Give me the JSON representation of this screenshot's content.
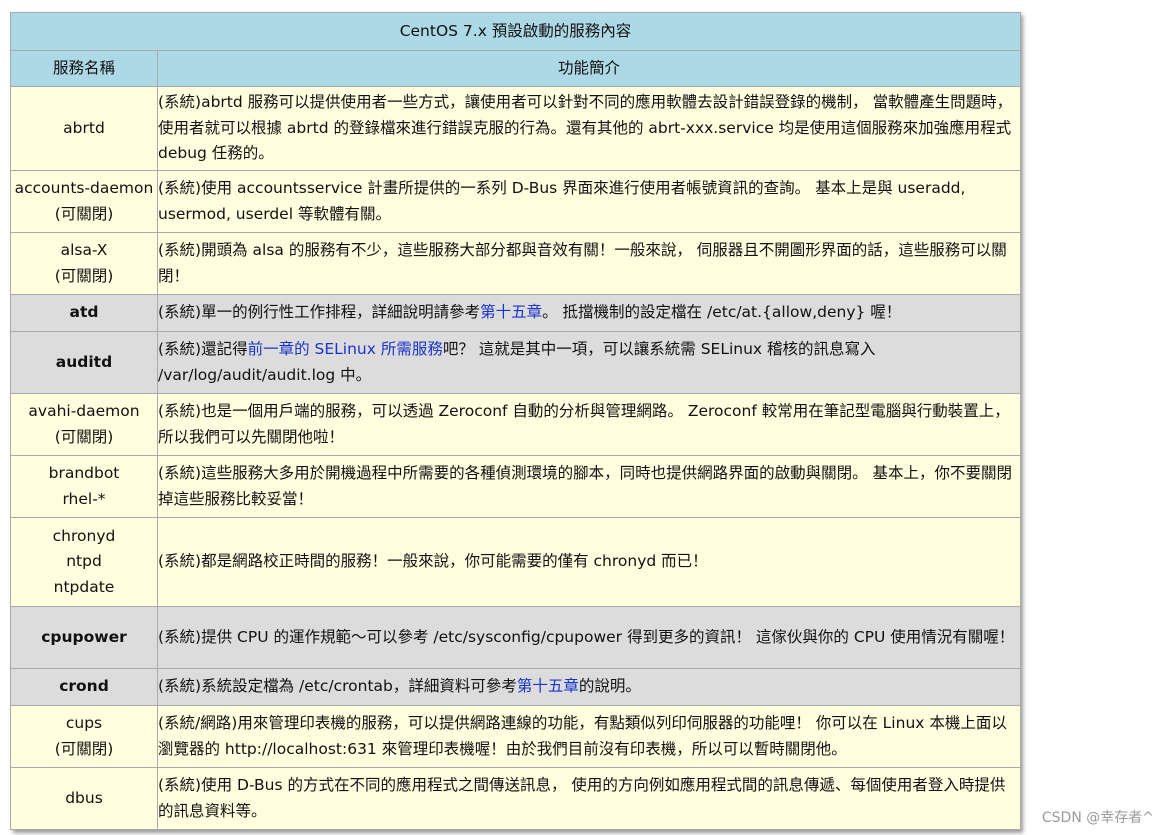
{
  "table": {
    "caption": "CentOS 7.x 預設啟動的服務內容",
    "headers": [
      "服務名稱",
      "功能簡介"
    ],
    "rows": [
      {
        "style": "yellow",
        "names": [
          "abrtd"
        ],
        "desc": [
          {
            "t": "(系統)abrtd 服務可以提供使用者一些方式，讓使用者可以針對不同的應用軟體去設計錯誤登錄的機制， 當軟體產生問題時，使用者就可以根據 abrtd 的登錄檔來進行錯誤克服的行為。還有其他的 abrt-xxx.service 均是使用這個服務來加強應用程式 debug 任務的。"
          }
        ]
      },
      {
        "style": "yellow",
        "names": [
          "accounts-daemon",
          "(可關閉)"
        ],
        "desc": [
          {
            "t": "(系統)使用 accountsservice 計畫所提供的一系列 D-Bus 界面來進行使用者帳號資訊的查詢。 基本上是與 useradd, usermod, userdel 等軟體有關。"
          }
        ]
      },
      {
        "style": "yellow",
        "names": [
          "alsa-X",
          "(可關閉)"
        ],
        "desc": [
          {
            "t": "(系統)開頭為 alsa 的服務有不少，這些服務大部分都與音效有關！一般來說， 伺服器且不開圖形界面的話，這些服務可以關閉！"
          }
        ]
      },
      {
        "style": "gray",
        "names": [
          "atd"
        ],
        "desc": [
          {
            "t": "(系統)單一的例行性工作排程，詳細說明請參考"
          },
          {
            "t": "第十五章",
            "link": true
          },
          {
            "t": "。 抵擋機制的設定檔在 /etc/at.{allow,deny} 喔！"
          }
        ]
      },
      {
        "style": "gray",
        "names": [
          "auditd"
        ],
        "desc": [
          {
            "t": "(系統)還記得"
          },
          {
            "t": "前一章的 SELinux 所需服務",
            "link": true
          },
          {
            "t": "吧？ 這就是其中一項，可以讓系統需 SELinux 稽核的訊息寫入 /var/log/audit/audit.log 中。"
          }
        ]
      },
      {
        "style": "yellow",
        "names": [
          "avahi-daemon",
          "(可關閉)"
        ],
        "desc": [
          {
            "t": "(系統)也是一個用戶端的服務，可以透過 Zeroconf 自動的分析與管理網路。 Zeroconf 較常用在筆記型電腦與行動裝置上，所以我們可以先關閉他啦！"
          }
        ]
      },
      {
        "style": "yellow",
        "names": [
          "brandbot",
          "rhel-*"
        ],
        "desc": [
          {
            "t": "(系統)這些服務大多用於開機過程中所需要的各種偵測環境的腳本，同時也提供網路界面的啟動與關閉。 基本上，你不要關閉掉這些服務比較妥當！"
          }
        ]
      },
      {
        "style": "yellow",
        "names": [
          "chronyd",
          "ntpd",
          "ntpdate"
        ],
        "desc": [
          {
            "t": "(系統)都是網路校正時間的服務！一般來說，你可能需要的僅有 chronyd 而已！"
          }
        ]
      },
      {
        "style": "gray",
        "names": [
          "cpupower"
        ],
        "desc": [
          {
            "t": "(系統)提供 CPU 的運作規範～可以參考 /etc/sysconfig/cpupower 得到更多的資訊！ 這傢伙與你的 CPU 使用情況有關喔！"
          }
        ]
      },
      {
        "style": "gray",
        "names": [
          "crond"
        ],
        "desc": [
          {
            "t": "(系統)系統設定檔為 /etc/crontab，詳細資料可參考"
          },
          {
            "t": "第十五章",
            "link": true
          },
          {
            "t": "的說明。"
          }
        ]
      },
      {
        "style": "yellow",
        "names": [
          "cups",
          "(可關閉)"
        ],
        "desc": [
          {
            "t": "(系統/網路)用來管理印表機的服務，可以提供網路連線的功能，有點類似列印伺服器的功能哩！ 你可以在 Linux 本機上面以瀏覽器的 http://localhost:631 來管理印表機喔！由於我們目前沒有印表機，所以可以暫時關閉他。"
          }
        ]
      },
      {
        "style": "yellow",
        "names": [
          "dbus"
        ],
        "desc": [
          {
            "t": "(系統)使用 D-Bus 的方式在不同的應用程式之間傳送訊息， 使用的方向例如應用程式間的訊息傳遞、每個使用者登入時提供的訊息資料等。"
          }
        ]
      }
    ]
  },
  "watermark": "CSDN @幸存者^",
  "colors": {
    "header_bg": "#add8e6",
    "row_yellow": "#ffffe0",
    "row_gray": "#dcdcdc",
    "link": "#1a33cc"
  }
}
